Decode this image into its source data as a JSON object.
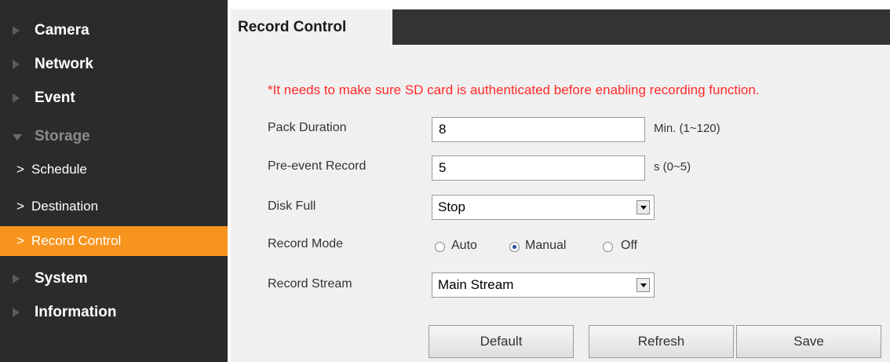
{
  "sidebar": {
    "items": [
      {
        "label": "Camera",
        "type": "section"
      },
      {
        "label": "Network",
        "type": "section"
      },
      {
        "label": "Event",
        "type": "section"
      },
      {
        "label": "Storage",
        "type": "section",
        "expanded": true
      },
      {
        "label": "Schedule",
        "type": "sub"
      },
      {
        "label": "Destination",
        "type": "sub"
      },
      {
        "label": "Record Control",
        "type": "sub",
        "active": true
      },
      {
        "label": "System",
        "type": "section"
      },
      {
        "label": "Information",
        "type": "section"
      }
    ]
  },
  "header": {
    "tab_label": "Record Control"
  },
  "form": {
    "notice": "*It needs to make sure SD card is authenticated before enabling recording function.",
    "pack_duration": {
      "label": "Pack Duration",
      "value": "8",
      "unit": "Min. (1~120)"
    },
    "pre_event": {
      "label": "Pre-event Record",
      "value": "5",
      "unit": "s (0~5)"
    },
    "disk_full": {
      "label": "Disk Full",
      "value": "Stop"
    },
    "record_mode": {
      "label": "Record Mode",
      "options": [
        "Auto",
        "Manual",
        "Off"
      ],
      "selected": "Manual"
    },
    "record_stream": {
      "label": "Record Stream",
      "value": "Main Stream"
    }
  },
  "buttons": {
    "default": "Default",
    "refresh": "Refresh",
    "save": "Save"
  },
  "colors": {
    "sidebar_bg": "#2b2b2b",
    "active_item": "#f7941d",
    "notice": "#ff2a2a",
    "radio_selected": "#1f4fa0"
  }
}
